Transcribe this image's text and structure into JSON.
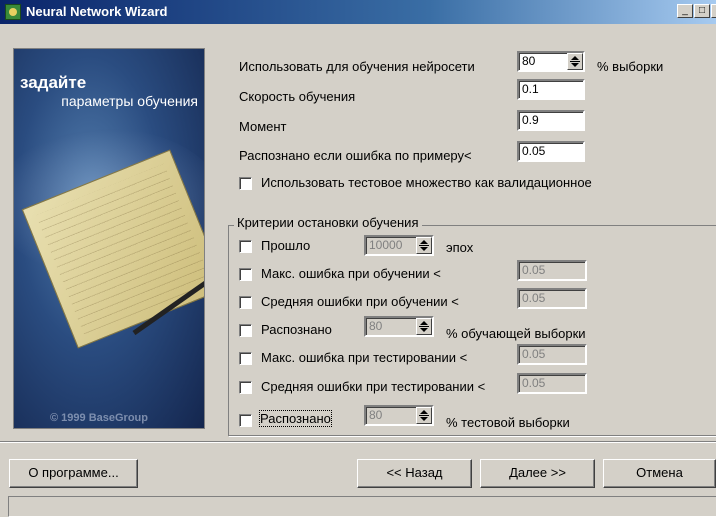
{
  "window": {
    "title": "Neural Network Wizard",
    "min": "_",
    "max": "□",
    "close": "×"
  },
  "banner": {
    "heading": "задайте",
    "subheading": "параметры обучения",
    "copyright": "© 1999 BaseGroup"
  },
  "params": {
    "train_percent_label": "Использовать для обучения нейросети",
    "train_percent_value": "80",
    "train_percent_unit": "% выборки",
    "learning_rate_label": "Скорость обучения",
    "learning_rate_value": "0.1",
    "momentum_label": "Момент",
    "momentum_value": "0.9",
    "recognized_error_label": "Распознано если ошибка по примеру<",
    "recognized_error_value": "0.05",
    "use_test_as_validation_label": "Использовать тестовое множество как валидационное",
    "use_test_as_validation_checked": false
  },
  "stop_criteria": {
    "title": "Критерии остановки обучения",
    "epochs_label": "Прошло",
    "epochs_value": "10000",
    "epochs_unit": "эпох",
    "max_train_error_label": "Макс. ошибка при обучении <",
    "max_train_error_value": "0.05",
    "avg_train_error_label": "Средняя ошибки при обучении <",
    "avg_train_error_value": "0.05",
    "recognized_train_label": "Распознано",
    "recognized_train_value": "80",
    "recognized_train_unit": "% обучающей выборки",
    "max_test_error_label": "Макс. ошибка при тестировании <",
    "max_test_error_value": "0.05",
    "avg_test_error_label": "Средняя ошибки при тестировании <",
    "avg_test_error_value": "0.05",
    "recognized_test_label": "Распознано",
    "recognized_test_value": "80",
    "recognized_test_unit": "% тестовой выборки"
  },
  "buttons": {
    "about": "О программе...",
    "back": "<< Назад",
    "next": "Далее >>",
    "cancel": "Отмена"
  }
}
